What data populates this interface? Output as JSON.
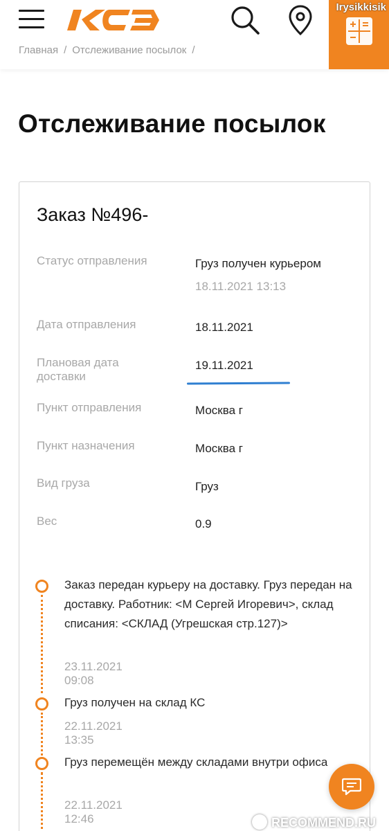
{
  "header": {
    "logo_text": "KCE",
    "username": "Irysikkisik",
    "accent_color": "#f08420"
  },
  "breadcrumb": {
    "home": "Главная",
    "current": "Отслеживание посылок",
    "separator": "/"
  },
  "page": {
    "title": "Отслеживание посылок"
  },
  "order": {
    "title": "Заказ №496-",
    "fields": [
      {
        "label": "Статус отправления",
        "value": "Груз получен курьером",
        "sub": "18.11.2021 13:13"
      },
      {
        "label": "Дата отправления",
        "value": "18.11.2021"
      },
      {
        "label": "Плановая дата доставки",
        "value": "19.11.2021"
      },
      {
        "label": "Пункт отправления",
        "value": "Москва г"
      },
      {
        "label": "Пункт назначения",
        "value": "Москва г"
      },
      {
        "label": "Вид груза",
        "value": "Груз"
      },
      {
        "label": "Вес",
        "value": "0.9"
      }
    ]
  },
  "timeline": [
    {
      "text": "Заказ передан курьеру на доставку. Груз передан на доставку. Работник: <М Сергей Игоревич>, склад списания: <СКЛАД (Угрешская стр.127)>",
      "date": "23.11.2021 09:08"
    },
    {
      "text": "Груз получен на склад КС",
      "date": "22.11.2021 13:35"
    },
    {
      "text": "Груз перемещён между складами внутри офиса",
      "date": "22.11.2021 12:46"
    }
  ],
  "watermark": "RECOMMEND.RU",
  "icons": {
    "menu": "hamburger-menu-icon",
    "search": "search-icon",
    "location": "map-pin-icon",
    "calculator": "calculator-icon",
    "chat": "chat-icon"
  }
}
